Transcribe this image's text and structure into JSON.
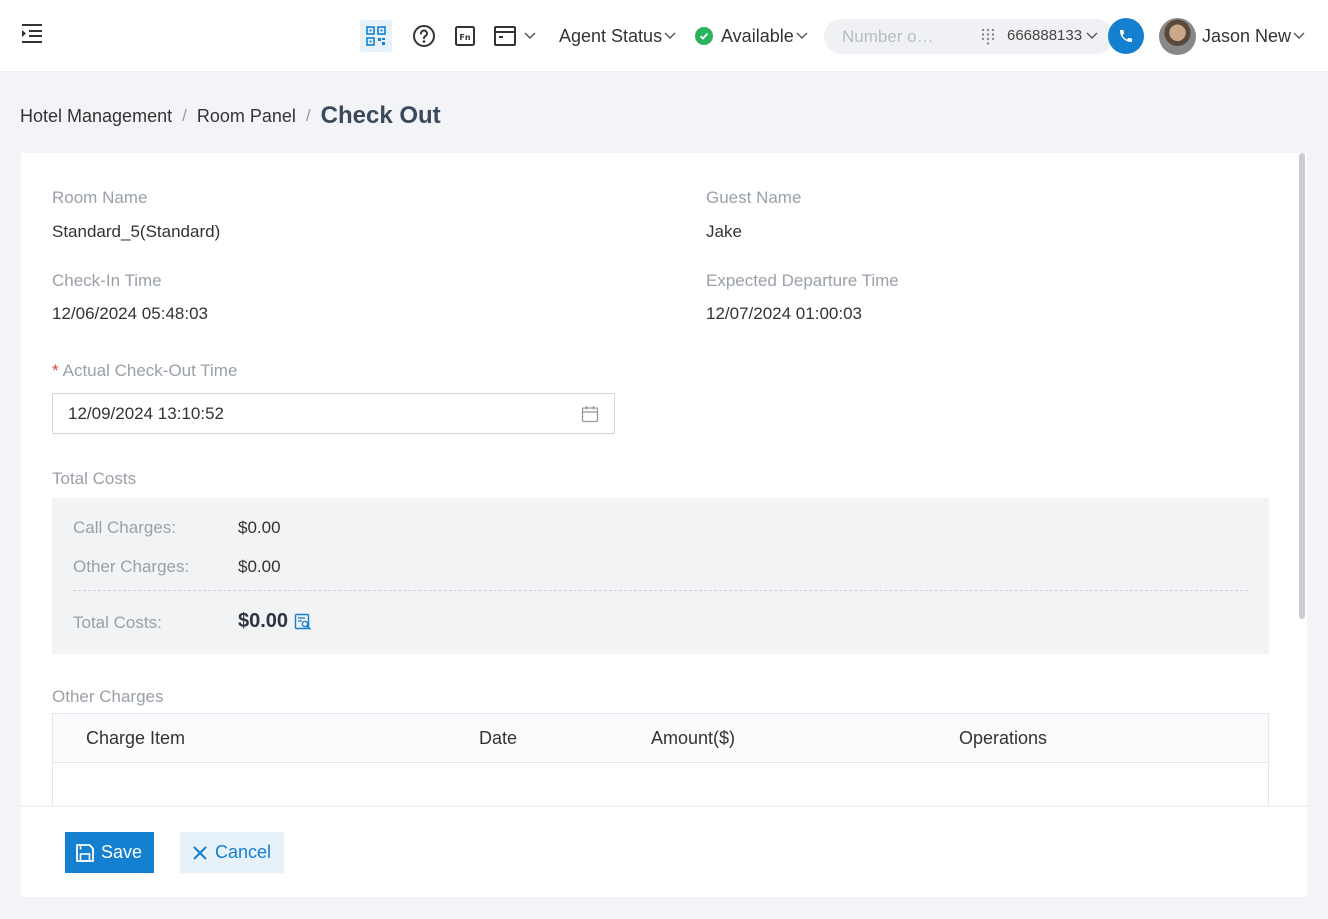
{
  "topbar": {
    "agent_status_label": "Agent Status",
    "availability": "Available",
    "dial_placeholder": "Number o…",
    "caller_id": "666888133",
    "user_name": "Jason New",
    "icons": [
      "menu-toggle-icon",
      "qr-code-icon",
      "help-icon",
      "fn-icon",
      "window-icon",
      "dialpad-icon",
      "phone-icon"
    ]
  },
  "breadcrumb": {
    "items": [
      "Hotel Management",
      "Room Panel"
    ],
    "separator": "/",
    "current": "Check Out"
  },
  "details": {
    "room_name_label": "Room Name",
    "room_name": "Standard_5(Standard)",
    "guest_name_label": "Guest Name",
    "guest_name": "Jake",
    "check_in_label": "Check-In Time",
    "check_in": "12/06/2024 05:48:03",
    "expected_departure_label": "Expected Departure Time",
    "expected_departure": "12/07/2024 01:00:03"
  },
  "checkout": {
    "required_mark": "*",
    "label": "Actual Check-Out Time",
    "value": "12/09/2024 13:10:52"
  },
  "costs": {
    "section_title": "Total Costs",
    "call_charges_label": "Call Charges:",
    "call_charges": "$0.00",
    "other_charges_label": "Other Charges:",
    "other_charges": "$0.00",
    "total_label": "Total Costs:",
    "total": "$0.00"
  },
  "other_charges": {
    "section_title": "Other Charges",
    "columns": [
      "Charge Item",
      "Date",
      "Amount($)",
      "Operations"
    ]
  },
  "footer": {
    "save_label": "Save",
    "cancel_label": "Cancel"
  },
  "colors": {
    "primary": "#1580d0",
    "available_green": "#27b45a",
    "required_red": "#e04545",
    "label_gray": "#9aa0a8"
  }
}
